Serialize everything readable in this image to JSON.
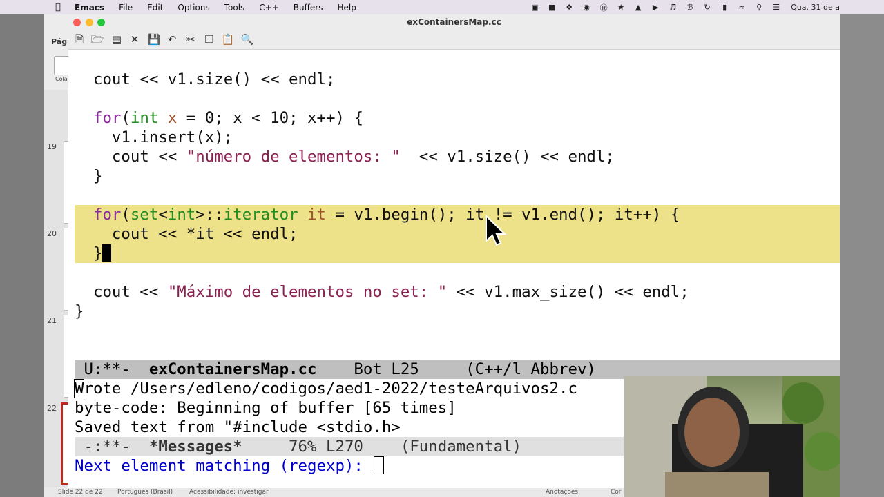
{
  "menubar": {
    "app_name": "Emacs",
    "items": [
      "File",
      "Edit",
      "Options",
      "Tools",
      "C++",
      "Buffers",
      "Help"
    ],
    "clock": "Qua. 31 de a"
  },
  "background_app": {
    "tab_label": "Pági",
    "paste_label": "Cola",
    "slide_numbers": [
      "19",
      "20",
      "21",
      "22"
    ],
    "status_slide": "Slide 22 de 22",
    "status_language": "Português (Brasil)",
    "status_accessibility": "Acessibilidade: investigar",
    "status_notes": "Anotações",
    "status_comments": "Cor"
  },
  "window": {
    "title": "exContainersMap.cc"
  },
  "code": {
    "line_cout_size": "cout << v1.size() << endl;",
    "for1_kw": "for",
    "for1_a": "(",
    "for1_type": "int",
    "for1_sp": " ",
    "for1_var": "x",
    "for1_rest": " = 0; x < 10; x++) {",
    "insert": "v1.insert(x);",
    "cout_pre": "cout << ",
    "cout_str": "\"número de elementos: \"",
    "cout_post": "  << v1.size() << endl;",
    "close1": "}",
    "for2_kw": "for",
    "for2_a": "(",
    "for2_set": "set",
    "for2_lt": "<",
    "for2_int": "int",
    "for2_gt": ">::",
    "for2_iter": "iterator",
    "for2_sp": " ",
    "for2_it": "it",
    "for2_rest": " = v1.begin(); it != v1.end(); it++) {",
    "cout_it": "cout << *it << endl;",
    "close2": "}",
    "max_pre": "cout << ",
    "max_str": "\"Máximo de elementos no set: \"",
    "max_post": " << v1.max_size() << endl;",
    "close_main": "}"
  },
  "modeline_main": {
    "state": " U:**-  ",
    "buffer": "exContainersMap.cc",
    "position": "    Bot L25     (C++/l Abbrev)"
  },
  "messages": {
    "line1_first": "W",
    "line1_rest": "rote /Users/edleno/codigos/aed1-2022/testeArquivos2.c",
    "line2": "byte-code: Beginning of buffer [65 times]",
    "line3": "Saved text from \"#include <stdio.h>"
  },
  "modeline_messages": {
    "state": " -:**-  ",
    "buffer": "*Messages*",
    "position": "     76% L270    (Fundamental)"
  },
  "minibuffer": {
    "prompt": "Next element matching (regexp): "
  },
  "colors": {
    "highlight": "#ede18a",
    "keyword": "#8a2b9a",
    "type": "#228b22",
    "variable": "#a0522d",
    "string": "#8b2252",
    "prompt": "#0000cd"
  }
}
